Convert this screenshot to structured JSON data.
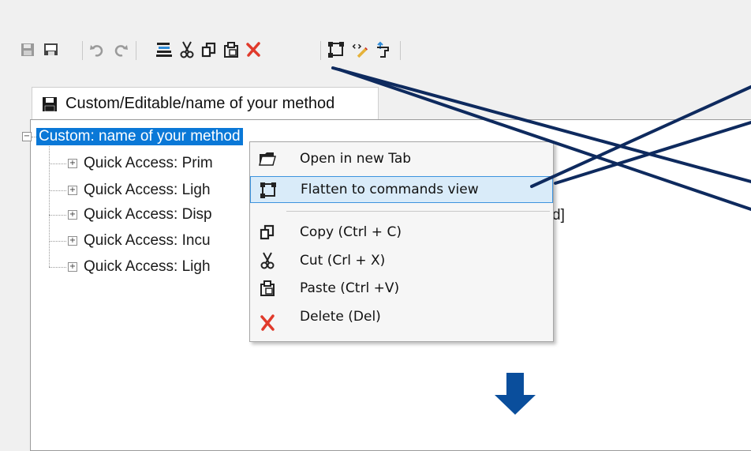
{
  "toolbar": {
    "buttons": [
      {
        "icon": "save-icon"
      },
      {
        "icon": "save-as-icon"
      },
      {
        "icon": "undo-icon"
      },
      {
        "icon": "redo-icon"
      },
      {
        "icon": "properties-icon"
      },
      {
        "icon": "cut-icon"
      },
      {
        "icon": "copy-icon"
      },
      {
        "icon": "paste-icon"
      },
      {
        "icon": "delete-icon"
      },
      {
        "icon": "flatten-icon"
      },
      {
        "icon": "script-edit-icon"
      },
      {
        "icon": "export-icon"
      }
    ]
  },
  "tab": {
    "label": "Custom/Editable/name of your method"
  },
  "tree": {
    "root": "Custom: name of your method",
    "children": [
      "Quick Access: Prim",
      "Quick Access: Ligh",
      "Quick Access: Disp",
      "Quick Access: Incu",
      "Quick Access: Ligh"
    ],
    "suffix_row3": "d]"
  },
  "context_menu": {
    "items": [
      {
        "icon": "folder-open-icon",
        "label": "Open in new Tab"
      },
      {
        "icon": "flatten-icon",
        "label": "Flatten to commands view"
      },
      {
        "icon": "copy-icon",
        "label": "Copy (Ctrl + C)"
      },
      {
        "icon": "cut-icon",
        "label": "Cut (Crl + X)"
      },
      {
        "icon": "paste-icon",
        "label": "Paste (Ctrl +V)"
      },
      {
        "icon": "delete-icon",
        "label": "Delete (Del)"
      }
    ],
    "highlighted_index": 1
  },
  "colors": {
    "selection": "#0a78d7",
    "annotation_lines": "#0e2a5e",
    "down_arrow": "#0a4e9c",
    "delete_red": "#e03a2b"
  }
}
